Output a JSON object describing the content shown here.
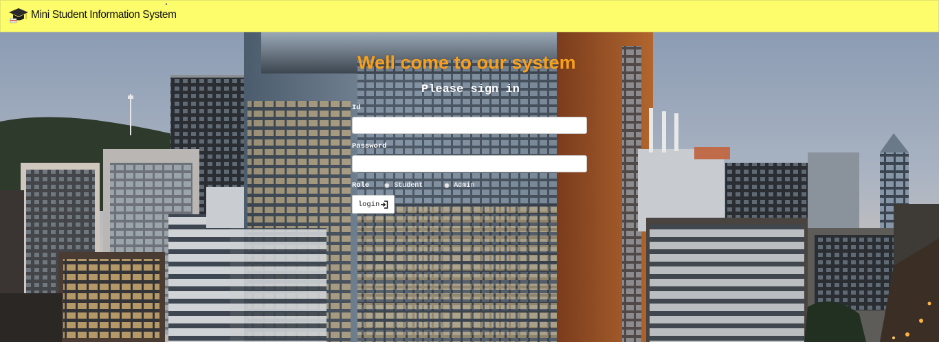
{
  "header": {
    "app_title": "Mini Student Information System",
    "logo_icon": "graduation-cap-icon",
    "background_color": "#fdfc6b"
  },
  "login": {
    "welcome_text": "Well come to our system",
    "welcome_color": "#f7a01c",
    "subtitle": "Please sign in",
    "id_label": "Id",
    "id_value": "",
    "password_label": "Password",
    "password_value": "",
    "role_label": "Role",
    "role_options": [
      "Student",
      "Admin"
    ],
    "login_button_label": "login",
    "login_icon": "sign-in-icon"
  }
}
